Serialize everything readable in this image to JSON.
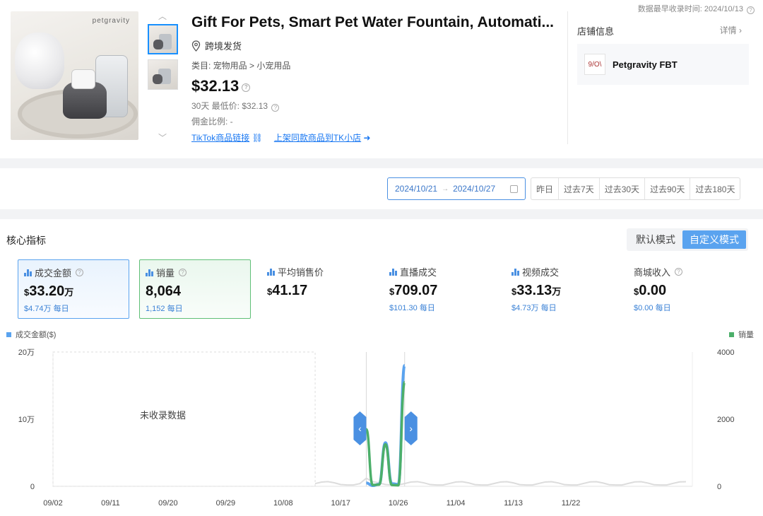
{
  "header": {
    "record_note": "数据最早收录时间: 2024/10/13"
  },
  "product": {
    "brand_watermark": "petgravity",
    "title": "Gift For Pets, Smart Pet Water Fountain, Automati...",
    "shipping": "跨境发货",
    "category": "类目: 宠物用品 > 小宠用品",
    "price": "$32.13",
    "low_price": "30天 最低价: $32.13",
    "commission": "佣金比例: -",
    "link_tiktok": "TikTok商品链接",
    "link_listing": "上架同款商品到TK小店"
  },
  "store": {
    "label": "店铺信息",
    "detail": "详情",
    "logo_text": "9/O\\",
    "name": "Petgravity FBT"
  },
  "date_filter": {
    "start": "2024/10/21",
    "end": "2024/10/27",
    "quick": [
      "昨日",
      "过去7天",
      "过去30天",
      "过去90天",
      "过去180天"
    ]
  },
  "metrics": {
    "section_title": "核心指标",
    "mode_default": "默认模式",
    "mode_custom": "自定义模式",
    "cards": [
      {
        "label": "成交金额",
        "currency": "$",
        "value": "33.20",
        "unit": "万",
        "sub": "$4.74万 每日"
      },
      {
        "label": "销量",
        "currency": "",
        "value": "8,064",
        "unit": "",
        "sub": "1,152 每日"
      },
      {
        "label": "平均销售价",
        "currency": "$",
        "value": "41.17",
        "unit": "",
        "sub": ""
      },
      {
        "label": "直播成交",
        "currency": "$",
        "value": "709.07",
        "unit": "",
        "sub": "$101.30 每日"
      },
      {
        "label": "视频成交",
        "currency": "$",
        "value": "33.13",
        "unit": "万",
        "sub": "$4.73万 每日"
      },
      {
        "label": "商城收入",
        "currency": "$",
        "value": "0.00",
        "unit": "",
        "sub": "$0.00 每日"
      }
    ]
  },
  "colors": {
    "gmv": "#5aa3ef",
    "sales": "#4caf6a",
    "history": "#dcdcdc"
  },
  "chart_data": {
    "type": "line",
    "no_data_label": "未收录数据",
    "x_ticks": [
      "09/02",
      "09/11",
      "09/20",
      "09/29",
      "10/08",
      "10/17",
      "10/26",
      "11/04",
      "11/13",
      "11/22"
    ],
    "y_left": {
      "label": "成交金额($)",
      "ticks": [
        "0",
        "10万",
        "20万"
      ],
      "range": [
        0,
        200000
      ]
    },
    "y_right": {
      "label": "销量",
      "ticks": [
        "0",
        "2000",
        "4000"
      ],
      "range": [
        0,
        4000
      ]
    },
    "series": [
      {
        "name": "成交金额($)",
        "axis": "left",
        "x": [
          "10/21",
          "10/22",
          "10/23",
          "10/24",
          "10/25",
          "10/26",
          "10/27"
        ],
        "values": [
          5000,
          1000,
          3000,
          65000,
          4000,
          3000,
          180000
        ]
      },
      {
        "name": "销量",
        "axis": "right",
        "x": [
          "10/21",
          "10/22",
          "10/23",
          "10/24",
          "10/25",
          "10/26",
          "10/27"
        ],
        "values": [
          1700,
          40,
          50,
          1250,
          40,
          30,
          3100
        ]
      }
    ]
  }
}
